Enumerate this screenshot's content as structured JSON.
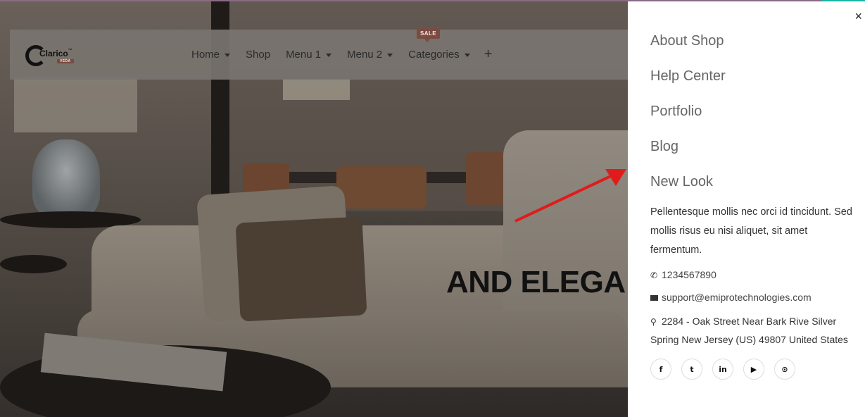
{
  "nav": {
    "logo_text": "Clarico",
    "logo_tm": "™",
    "logo_badge": "VEDA",
    "items": [
      {
        "label": "Home",
        "dropdown": true
      },
      {
        "label": "Shop",
        "dropdown": false
      },
      {
        "label": "Menu 1",
        "dropdown": true
      },
      {
        "label": "Menu 2",
        "dropdown": true
      },
      {
        "label": "Categories",
        "dropdown": true
      }
    ],
    "sale_badge": "SALE",
    "plus_icon": "+"
  },
  "hero": {
    "headline": "AND ELEGA"
  },
  "panel": {
    "close_icon": "×",
    "links": [
      "About Shop",
      "Help Center",
      "Portfolio",
      "Blog",
      "New Look"
    ],
    "description": "Pellentesque mollis nec orci id tincidunt. Sed mollis risus eu nisi aliquet, sit amet fermentum.",
    "phone": "1234567890",
    "email": "support@emiprotechnologies.com",
    "address": "2284 - Oak Street Near Bark Rive Silver Spring New Jersey (US) 49807 United States",
    "social": [
      {
        "icon": "facebook-icon",
        "glyph": "f"
      },
      {
        "icon": "twitter-icon",
        "glyph": "t"
      },
      {
        "icon": "linkedin-icon",
        "glyph": "in"
      },
      {
        "icon": "youtube-icon",
        "glyph": "▶"
      },
      {
        "icon": "github-icon",
        "glyph": "⊙"
      }
    ]
  },
  "colors": {
    "accent_line": "#8a6a85",
    "teal_accent": "#19b3a6",
    "sale_badge": "#7b4b42",
    "arrow": "#e11b1b"
  }
}
